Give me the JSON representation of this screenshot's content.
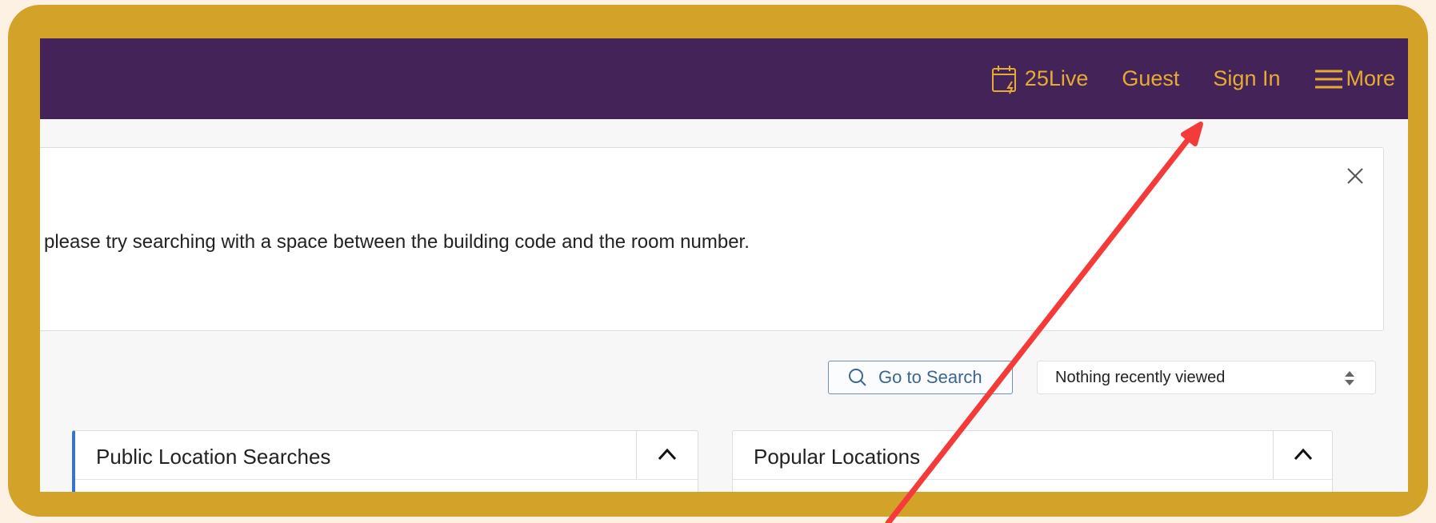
{
  "nav": {
    "live_label": "25Live",
    "guest_label": "Guest",
    "sign_in_label": "Sign In",
    "more_label": "More"
  },
  "banner": {
    "text": "please try searching with a space between the building code and the room number."
  },
  "search": {
    "go_label": "Go to Search",
    "recent_selected": "Nothing recently viewed"
  },
  "panels": {
    "left_title": "Public Location Searches",
    "right_title": "Popular Locations"
  },
  "colors": {
    "frame": "#d3a229",
    "topbar": "#432358",
    "nav_text": "#e6ac31",
    "annotation_arrow": "#f53a3a",
    "accent_blue": "#3b74c7"
  }
}
